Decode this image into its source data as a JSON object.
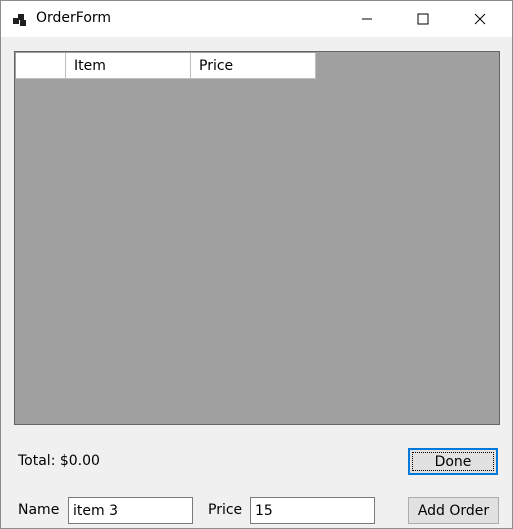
{
  "window": {
    "title": "OrderForm",
    "icons": {
      "app": "app-icon",
      "minimize": "minimize-icon",
      "maximize": "maximize-icon",
      "close": "close-icon"
    }
  },
  "grid": {
    "columns": [
      "",
      "Item",
      "Price"
    ],
    "rows": []
  },
  "total": {
    "text": "Total: $0.00"
  },
  "buttons": {
    "done": "Done",
    "add_order": "Add Order"
  },
  "form": {
    "name_label": "Name",
    "name_value": "item 3",
    "price_label": "Price",
    "price_value": "15"
  },
  "colors": {
    "grid_background": "#a0a0a0",
    "focus_border": "#0078d7",
    "window_background": "#f0f0f0"
  }
}
